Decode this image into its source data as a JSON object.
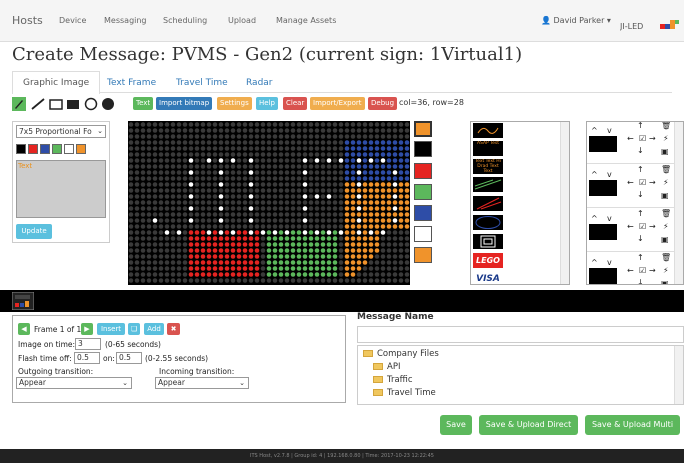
{
  "nav": {
    "brand": "Hosts",
    "items": [
      "Device",
      "Messaging",
      "Scheduling",
      "Upload",
      "Manage Assets"
    ],
    "user": "David Parker",
    "logo": "JI-LED"
  },
  "title": "Create Message: PVMS - Gen2 (current sign: 1Virtual1)",
  "tabs": [
    "Graphic Image",
    "Text Frame",
    "Travel Time",
    "Radar"
  ],
  "toolbar": {
    "buttons": [
      {
        "label": "Text",
        "color": "#5cb85c"
      },
      {
        "label": "Import bitmap",
        "color": "#337ab7"
      },
      {
        "label": "Settings",
        "color": "#f0ad4e"
      },
      {
        "label": "Help",
        "color": "#5bc0de"
      },
      {
        "label": "Clear",
        "color": "#d9534f"
      },
      {
        "label": "Import/Export",
        "color": "#f0ad4e"
      },
      {
        "label": "Debug",
        "color": "#d9534f"
      }
    ],
    "coords": "col=36, row=28"
  },
  "palette": {
    "font": "7x5 Proportional Fo",
    "swatches": [
      "#000000",
      "#e52421",
      "#2e4da7",
      "#5cb85c",
      "#ffffff",
      "#f0932b"
    ],
    "text": "Text",
    "update": "Update"
  },
  "colors": [
    "#f0932b",
    "#000000",
    "#e52421",
    "#5cb85c",
    "#2e4da7",
    "#ffffff",
    "#f0932b"
  ],
  "board": {
    "text": "JILED",
    "text_color": "#ffffff",
    "blocks": [
      {
        "color": "#2e4da7"
      },
      {
        "color": "#f0932b"
      },
      {
        "color": "#e52421"
      },
      {
        "color": "#5cb85c"
      },
      {
        "color": "#f0932b"
      }
    ]
  },
  "thumbs": [
    "",
    "ASAP Test",
    "Text Text Hi Drad Text Text",
    "",
    "",
    "",
    "",
    "LEGO",
    "VISA"
  ],
  "slots_icons": {
    "up": "↑",
    "down": "↓",
    "left": "←",
    "right": "→",
    "trash": "🗑",
    "image": "▣",
    "bolt": "⚡",
    "chev_up": "^",
    "chev_down": "v"
  },
  "frame": {
    "label": "Frame 1 of 1",
    "insert": "Insert",
    "add": "Add",
    "on_time_label": "Image on time:",
    "on_time": "3",
    "on_time_hint": "(0-65 seconds)",
    "flash_label": "Flash time off:",
    "flash_off": "0.5",
    "on_label": "on:",
    "flash_on": "0.5",
    "flash_hint": "(0-2.55 seconds)",
    "out_label": "Outgoing transition:",
    "out_value": "Appear",
    "in_label": "Incoming transition:",
    "in_value": "Appear"
  },
  "message": {
    "name_label": "Message Name",
    "tree": [
      "Company Files",
      "API",
      "Traffic",
      "Travel Time"
    ]
  },
  "buttons": {
    "save": "Save",
    "save_direct": "Save & Upload Direct",
    "save_multi": "Save & Upload Multi"
  },
  "footer": "ITS Host, v2.7.8 | Group id: 4 | 192.168.0.80 | Time: 2017-10-23 12:22:45"
}
